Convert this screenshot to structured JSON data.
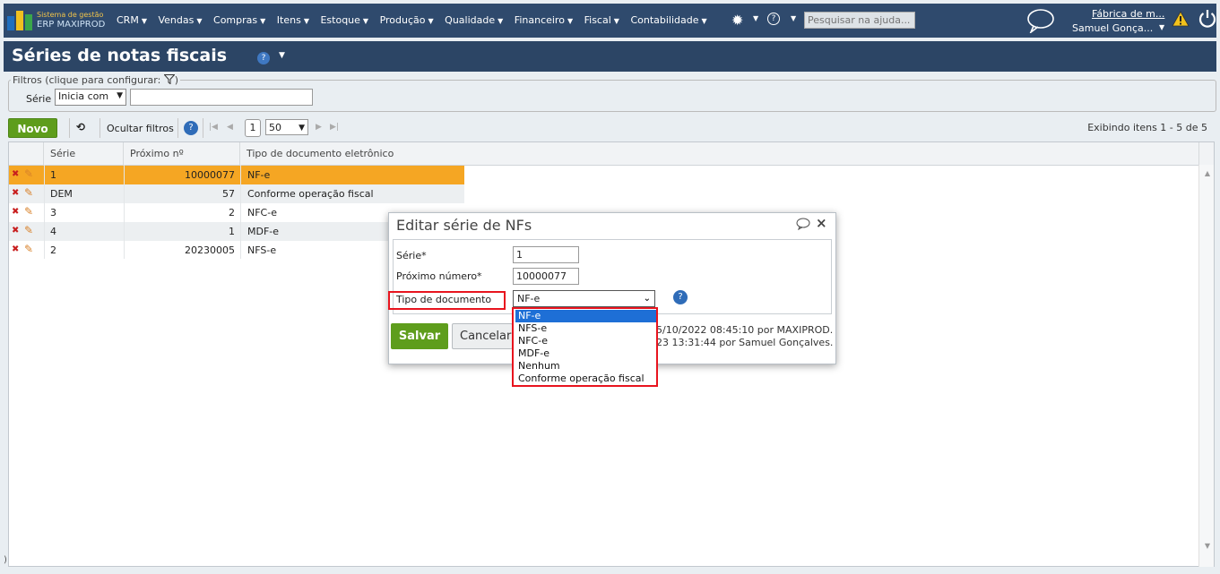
{
  "app": {
    "brand_line1": "Sistema de gestão",
    "brand_line2": "ERP MAXIPROD",
    "menu": [
      "CRM",
      "Vendas",
      "Compras",
      "Itens",
      "Estoque",
      "Produção",
      "Qualidade",
      "Financeiro",
      "Fiscal",
      "Contabilidade"
    ],
    "search_placeholder": "Pesquisar na ajuda...",
    "company": "Fábrica de m...",
    "user": "Samuel Gonça...",
    "icons": [
      "gear-icon",
      "help-icon",
      "chat-icon",
      "warning-icon",
      "power-icon"
    ]
  },
  "page": {
    "title": "Séries de notas fiscais"
  },
  "filters": {
    "legend": "Filtros (clique para configurar:",
    "legend_end": ")",
    "field_label": "Série",
    "operator": "Inicia com",
    "value": ""
  },
  "toolbar": {
    "new_label": "Novo",
    "hide_filters": "Ocultar filtros",
    "page": "1",
    "per_page": "50",
    "items_info": "Exibindo itens 1 - 5 de 5"
  },
  "grid": {
    "columns": [
      "Série",
      "Próximo nº",
      "Tipo de documento eletrônico"
    ],
    "rows": [
      {
        "serie": "1",
        "proximo": "10000077",
        "tipo": "NF-e"
      },
      {
        "serie": "DEM",
        "proximo": "57",
        "tipo": "Conforme operação fiscal"
      },
      {
        "serie": "3",
        "proximo": "2",
        "tipo": "NFC-e"
      },
      {
        "serie": "4",
        "proximo": "1",
        "tipo": "MDF-e"
      },
      {
        "serie": "2",
        "proximo": "20230005",
        "tipo": "NFS-e"
      }
    ],
    "status": ")"
  },
  "modal": {
    "title": "Editar série de NFs",
    "serie_label": "Série*",
    "serie_value": "1",
    "proximo_label": "Próximo número*",
    "proximo_value": "10000077",
    "tipo_label": "Tipo de documento",
    "tipo_value": "NF-e",
    "save_label": "Salvar",
    "cancel_label": "Cancelar",
    "audit_line1": "5/10/2022 08:45:10 por MAXIPROD.",
    "audit_line2": "23 13:31:44 por Samuel Gonçalves.",
    "options": [
      "NF-e",
      "NFS-e",
      "NFC-e",
      "MDF-e",
      "Nenhum",
      "Conforme operação fiscal"
    ],
    "selected_option": "NF-e"
  },
  "colors": {
    "navbar": "#2f4a6d",
    "selected_row": "#f5a623",
    "save_green": "#5e9d1c",
    "highlight_red": "#e8141e",
    "option_blue": "#1e6fd6"
  }
}
